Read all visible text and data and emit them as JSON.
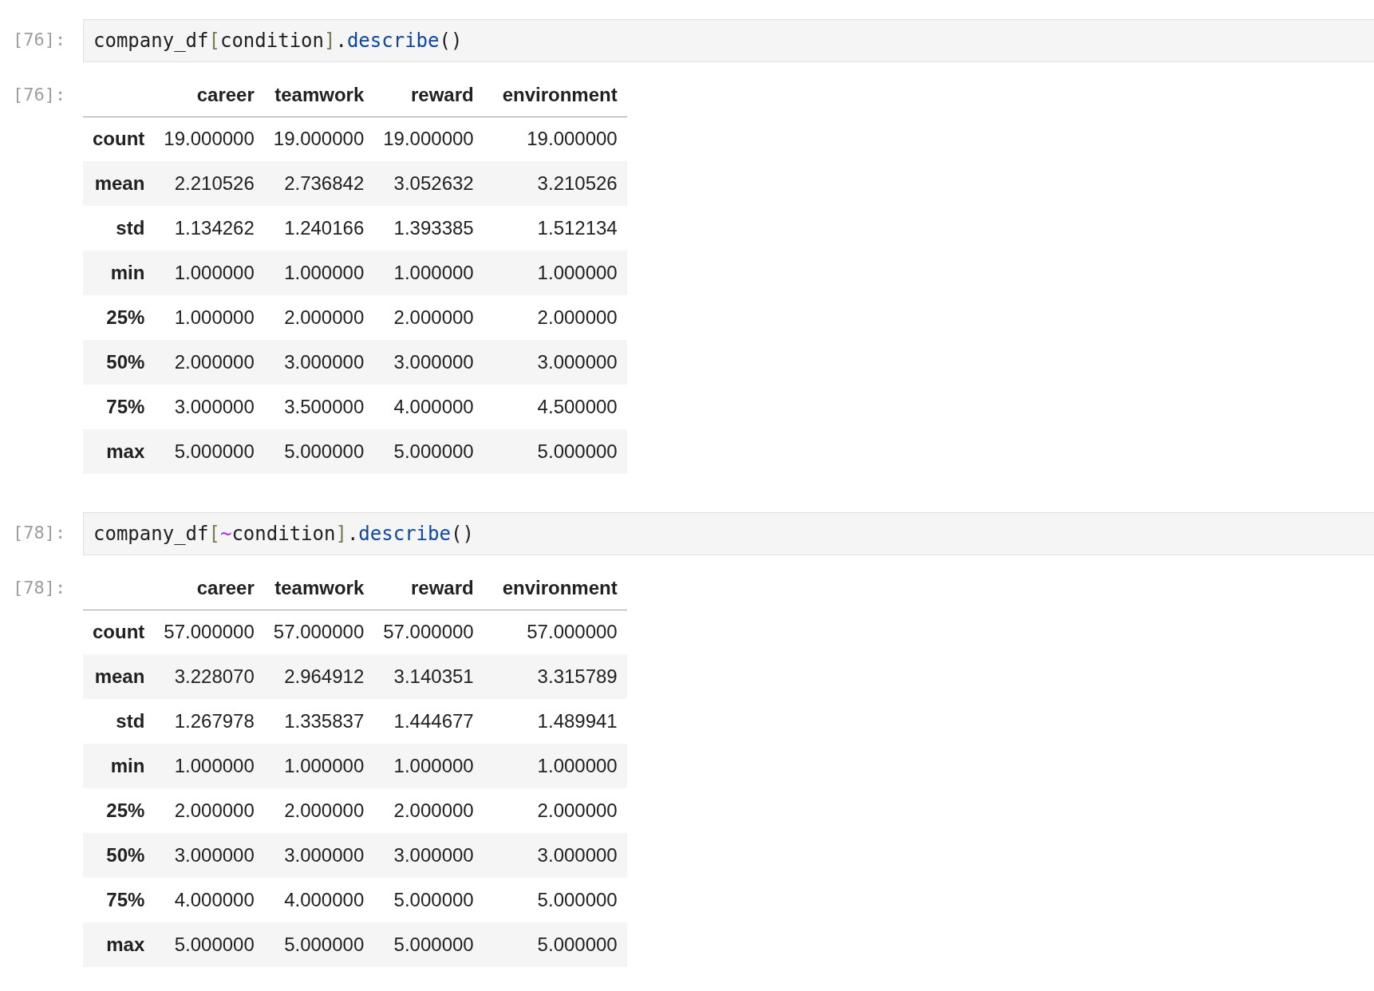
{
  "cells": [
    {
      "input_prompt": "[76]:",
      "code": [
        {
          "kind": "name",
          "text": "company_df"
        },
        {
          "kind": "bracket",
          "text": "["
        },
        {
          "kind": "name",
          "text": "condition"
        },
        {
          "kind": "bracket",
          "text": "]"
        },
        {
          "kind": "name",
          "text": "."
        },
        {
          "kind": "method",
          "text": "describe"
        },
        {
          "kind": "name",
          "text": "()"
        }
      ],
      "output_prompt": "[76]:",
      "table": {
        "columns": [
          "career",
          "teamwork",
          "reward",
          "environment"
        ],
        "rows": [
          {
            "label": "count",
            "values": [
              "19.000000",
              "19.000000",
              "19.000000",
              "19.000000"
            ]
          },
          {
            "label": "mean",
            "values": [
              "2.210526",
              "2.736842",
              "3.052632",
              "3.210526"
            ]
          },
          {
            "label": "std",
            "values": [
              "1.134262",
              "1.240166",
              "1.393385",
              "1.512134"
            ]
          },
          {
            "label": "min",
            "values": [
              "1.000000",
              "1.000000",
              "1.000000",
              "1.000000"
            ]
          },
          {
            "label": "25%",
            "values": [
              "1.000000",
              "2.000000",
              "2.000000",
              "2.000000"
            ]
          },
          {
            "label": "50%",
            "values": [
              "2.000000",
              "3.000000",
              "3.000000",
              "3.000000"
            ]
          },
          {
            "label": "75%",
            "values": [
              "3.000000",
              "3.500000",
              "4.000000",
              "4.500000"
            ]
          },
          {
            "label": "max",
            "values": [
              "5.000000",
              "5.000000",
              "5.000000",
              "5.000000"
            ]
          }
        ]
      }
    },
    {
      "input_prompt": "[78]:",
      "code": [
        {
          "kind": "name",
          "text": "company_df"
        },
        {
          "kind": "bracket",
          "text": "["
        },
        {
          "kind": "operator",
          "text": "~"
        },
        {
          "kind": "name",
          "text": "condition"
        },
        {
          "kind": "bracket",
          "text": "]"
        },
        {
          "kind": "name",
          "text": "."
        },
        {
          "kind": "method",
          "text": "describe"
        },
        {
          "kind": "name",
          "text": "()"
        }
      ],
      "output_prompt": "[78]:",
      "table": {
        "columns": [
          "career",
          "teamwork",
          "reward",
          "environment"
        ],
        "rows": [
          {
            "label": "count",
            "values": [
              "57.000000",
              "57.000000",
              "57.000000",
              "57.000000"
            ]
          },
          {
            "label": "mean",
            "values": [
              "3.228070",
              "2.964912",
              "3.140351",
              "3.315789"
            ]
          },
          {
            "label": "std",
            "values": [
              "1.267978",
              "1.335837",
              "1.444677",
              "1.489941"
            ]
          },
          {
            "label": "min",
            "values": [
              "1.000000",
              "1.000000",
              "1.000000",
              "1.000000"
            ]
          },
          {
            "label": "25%",
            "values": [
              "2.000000",
              "2.000000",
              "2.000000",
              "2.000000"
            ]
          },
          {
            "label": "50%",
            "values": [
              "3.000000",
              "3.000000",
              "3.000000",
              "3.000000"
            ]
          },
          {
            "label": "75%",
            "values": [
              "4.000000",
              "4.000000",
              "5.000000",
              "5.000000"
            ]
          },
          {
            "label": "max",
            "values": [
              "5.000000",
              "5.000000",
              "5.000000",
              "5.000000"
            ]
          }
        ]
      }
    }
  ]
}
